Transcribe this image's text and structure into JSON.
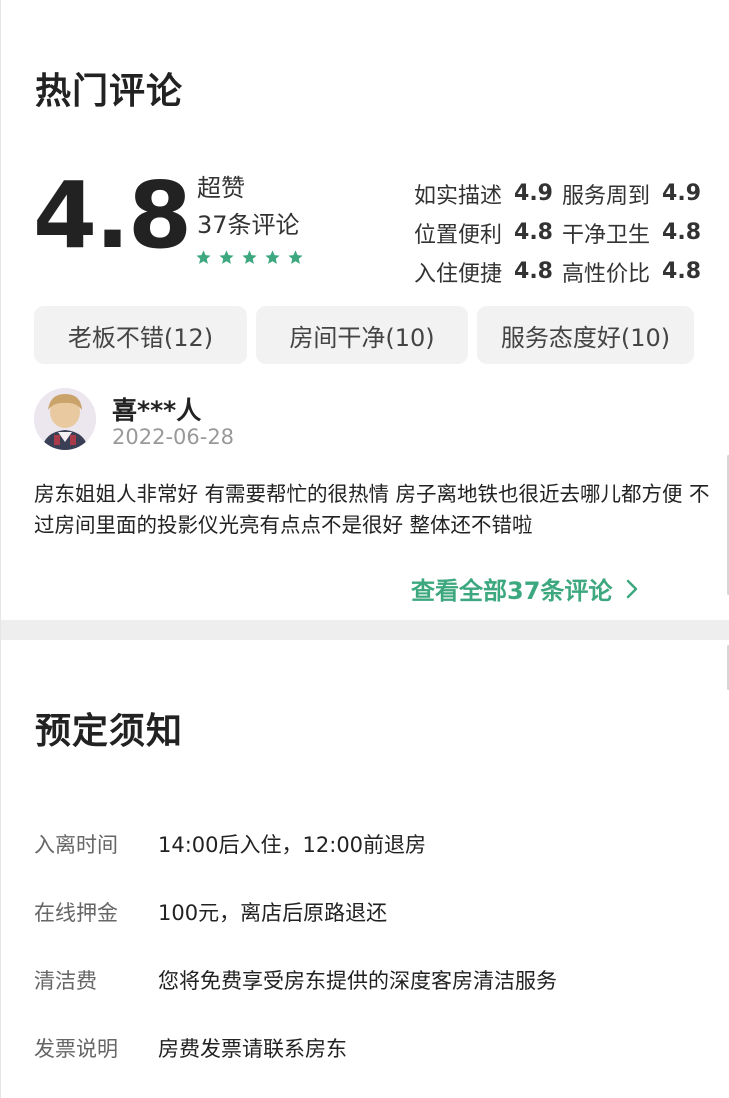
{
  "reviews": {
    "title": "热门评论",
    "score": "4.8",
    "score_word": "超赞",
    "review_count": "37条评论",
    "stars_rating": 5,
    "star_color": "#3da87f",
    "sub_scores": [
      {
        "label": "如实描述",
        "value": "4.9"
      },
      {
        "label": "服务周到",
        "value": "4.9"
      },
      {
        "label": "位置便利",
        "value": "4.8"
      },
      {
        "label": "干净卫生",
        "value": "4.8"
      },
      {
        "label": "入住便捷",
        "value": "4.8"
      },
      {
        "label": "高性价比",
        "value": "4.8"
      }
    ],
    "tags": [
      "老板不错(12)",
      "房间干净(10)",
      "服务态度好(10)"
    ],
    "review": {
      "name": "喜***人",
      "date": "2022-06-28",
      "text": "房东姐姐人非常好 有需要帮忙的很热情 房子离地铁也很近去哪儿都方便 不过房间里面的投影仪光亮有点点不是很好 整体还不错啦"
    },
    "see_all": "查看全部37条评论",
    "accent_color": "#3da87f"
  },
  "booking": {
    "title": "预定须知",
    "items": [
      {
        "label": "入离时间",
        "value": "14:00后入住，12:00前退房"
      },
      {
        "label": "在线押金",
        "value": "100元，离店后原路退还"
      },
      {
        "label": "清洁费",
        "value": "您将免费享受房东提供的深度客房清洁服务"
      },
      {
        "label": "发票说明",
        "value": "房费发票请联系房东"
      }
    ]
  }
}
